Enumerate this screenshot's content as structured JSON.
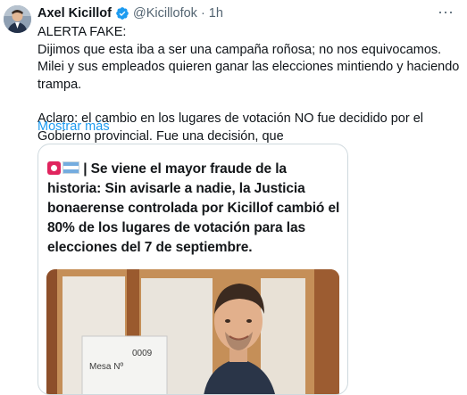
{
  "tweet": {
    "author_name": "Axel Kicillof",
    "handle": "@Kicillofok",
    "separator": "·",
    "time": "1h",
    "more_icon": "more-icon",
    "paragraphs": [
      "ALERTA FAKE:",
      "Dijimos que esta iba a ser una campaña roñosa; no nos equivocamos. Milei y sus empleados quieren ganar las elecciones mintiendo y haciendo trampa.",
      "Aclaro: el cambio en los lugares de votación NO fue decidido por el Gobierno provincial. Fue una decisión, que"
    ],
    "show_more": "Mostrar más"
  },
  "quoted": {
    "headline": "| Se viene el mayor fraude de la historia: Sin avisarle a nadie, la Justicia bonaerense controlada por Kicillof cambió el 80% de los lugares de votación para las elecciones del 7 de septiembre.",
    "photo_sign_number": "0009",
    "photo_sign_text": "Mesa Nº"
  },
  "colors": {
    "link": "#1d9bf0",
    "verified": "#1d9bf0",
    "secondary_text": "#536471"
  }
}
